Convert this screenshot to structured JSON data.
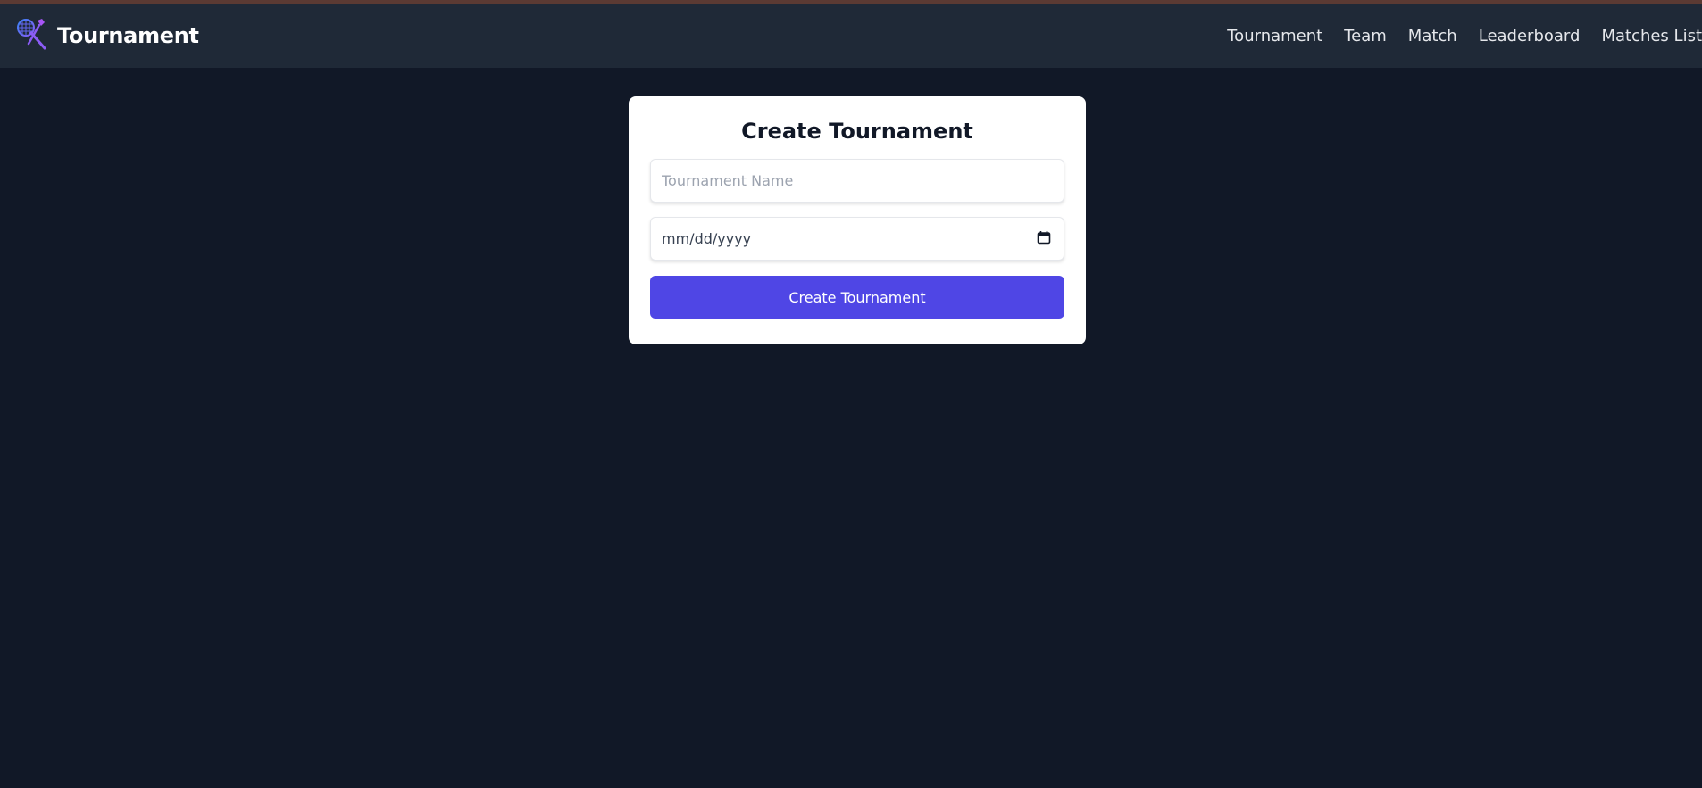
{
  "app": {
    "brand_title": "Tournament",
    "brand_icon": "badminton-rackets-icon"
  },
  "nav": {
    "items": [
      {
        "label": "Tournament"
      },
      {
        "label": "Team"
      },
      {
        "label": "Match"
      },
      {
        "label": "Leaderboard"
      },
      {
        "label": "Matches List"
      }
    ]
  },
  "form": {
    "title": "Create Tournament",
    "name_field": {
      "placeholder": "Tournament Name",
      "value": ""
    },
    "date_field": {
      "display": "mm/dd/yyyy",
      "icon": "calendar-icon"
    },
    "submit_label": "Create Tournament"
  },
  "colors": {
    "background": "#111827",
    "navbar": "#1f2937",
    "accent": "#4f46e5",
    "card": "#ffffff"
  }
}
